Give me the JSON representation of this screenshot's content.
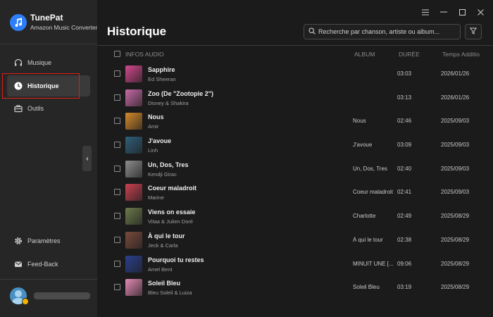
{
  "app": {
    "title": "TunePat",
    "subtitle": "Amazon Music Converter"
  },
  "sidebar": {
    "items": [
      {
        "label": "Musique",
        "icon": "headphones-icon"
      },
      {
        "label": "Historique",
        "icon": "clock-icon",
        "active": true
      },
      {
        "label": "Outils",
        "icon": "toolbox-icon"
      }
    ],
    "bottom_items": [
      {
        "label": "Paramètres",
        "icon": "gear-icon"
      },
      {
        "label": "Feed-Back",
        "icon": "mail-icon"
      }
    ]
  },
  "main": {
    "page_title": "Historique",
    "search_placeholder": "Recherche par chanson, artiste ou album...",
    "columns": {
      "info": "INFOS AUDIO",
      "album": "ALBUM",
      "duration": "DURÉE",
      "added": "Temps Additio"
    },
    "tracks": [
      {
        "title": "Sapphire",
        "artist": "Ed Sheeran",
        "album": "",
        "duration": "03:03",
        "date": "2026/01/26",
        "color": "#d2478d"
      },
      {
        "title": "Zoo (De \"Zootopie 2\")",
        "artist": "Disney & Shakira",
        "album": "",
        "duration": "03:13",
        "date": "2026/01/26",
        "color": "#c86aa8"
      },
      {
        "title": "Nous",
        "artist": "Amir",
        "album": "Nous",
        "duration": "02:46",
        "date": "2025/09/03",
        "color": "#d48a2a"
      },
      {
        "title": "J'avoue",
        "artist": "Linh",
        "album": "J'avoue",
        "duration": "03:09",
        "date": "2025/09/03",
        "color": "#2f5f7a"
      },
      {
        "title": "Un, Dos, Tres",
        "artist": "Kendji Girac",
        "album": "Un, Dos, Tres",
        "duration": "02:40",
        "date": "2025/09/03",
        "color": "#8d8d8d"
      },
      {
        "title": "Coeur maladroit",
        "artist": "Marine",
        "album": "Coeur maladroit",
        "duration": "02:41",
        "date": "2025/09/03",
        "color": "#c9414f"
      },
      {
        "title": "Viens on essaie",
        "artist": "Vitaa & Julien Doré",
        "album": "Charlotte",
        "duration": "02:49",
        "date": "2025/08/29",
        "color": "#6c7a4a"
      },
      {
        "title": "À qui le tour",
        "artist": "Jeck & Carla",
        "album": "À qui le tour",
        "duration": "02:38",
        "date": "2025/08/29",
        "color": "#7a4a3c"
      },
      {
        "title": "Pourquoi tu restes",
        "artist": "Amel Bent",
        "album": "MINUIT UNE [...",
        "duration": "09:06",
        "date": "2025/08/29",
        "color": "#2a3f8f"
      },
      {
        "title": "Soleil Bleu",
        "artist": "Bleu Soleil & Luiza",
        "album": "Soleil Bleu",
        "duration": "03:19",
        "date": "2025/08/29",
        "color": "#e48ab4"
      }
    ]
  },
  "colors": {
    "accent": "#2d7ff9",
    "highlight_outline": "#e0201b",
    "sidebar_bg": "#262626",
    "main_bg": "#1b1b1b"
  }
}
